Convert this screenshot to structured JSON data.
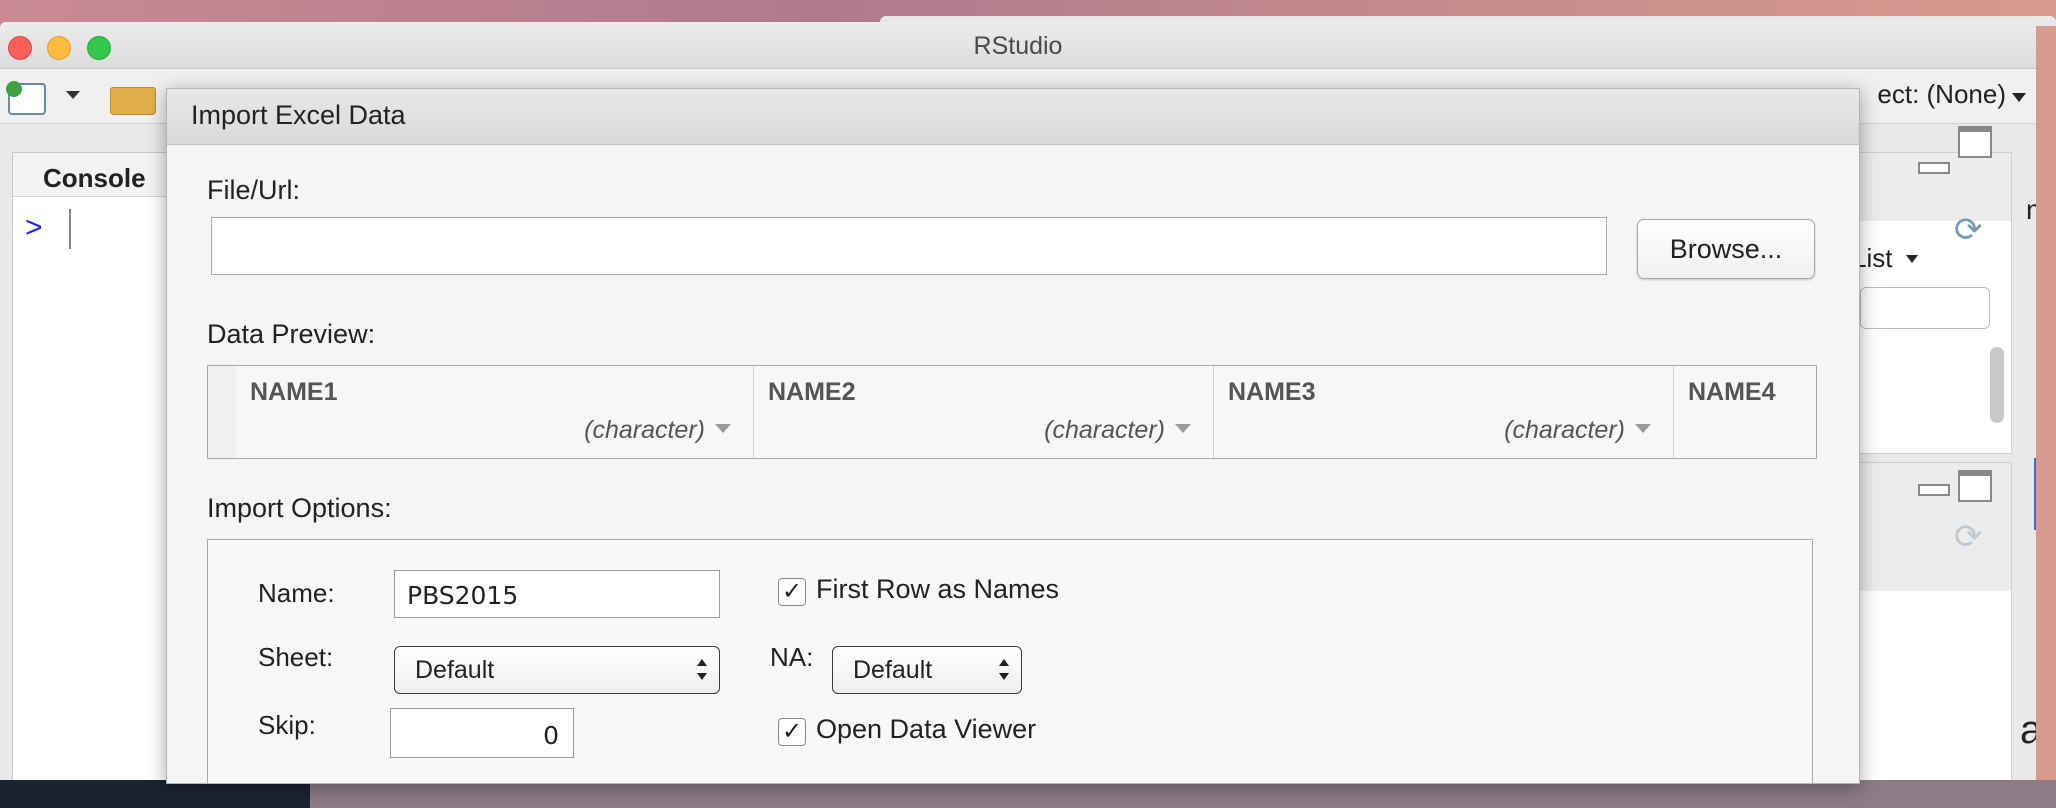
{
  "window": {
    "title": "RStudio"
  },
  "toolbar": {
    "project_label": "ect: (None)"
  },
  "console": {
    "tab_label": "Console",
    "prompt": ">"
  },
  "environment": {
    "list_label": "List"
  },
  "edge": {
    "right_top": "m",
    "right_bottom": "ar"
  },
  "dialog": {
    "title": "Import Excel Data",
    "file_label": "File/Url:",
    "file_value": "",
    "browse_label": "Browse...",
    "preview_label": "Data Preview:",
    "columns": [
      {
        "name": "NAME1",
        "type": "(character)"
      },
      {
        "name": "NAME2",
        "type": "(character)"
      },
      {
        "name": "NAME3",
        "type": "(character)"
      },
      {
        "name": "NAME4",
        "type": ""
      }
    ],
    "options_label": "Import Options:",
    "options": {
      "name_label": "Name:",
      "name_value": "PBS2015",
      "sheet_label": "Sheet:",
      "sheet_value": "Default",
      "skip_label": "Skip:",
      "skip_value": "0",
      "first_row_label": "First Row as Names",
      "first_row_checked": "✓",
      "na_label": "NA:",
      "na_value": "Default",
      "open_viewer_label": "Open Data Viewer",
      "open_viewer_checked": "✓"
    }
  }
}
